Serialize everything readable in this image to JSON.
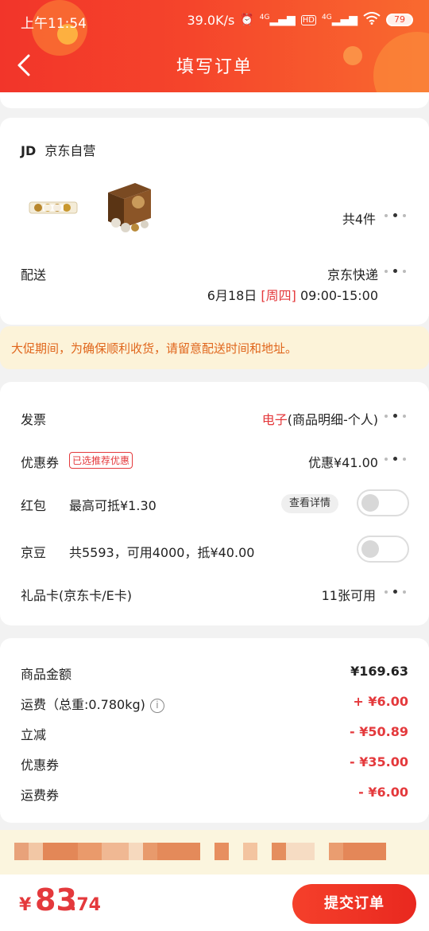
{
  "status_bar": {
    "time": "上午11:54",
    "net_speed": "39.0K/s",
    "battery": "79",
    "signal1": "4G",
    "hd": "HD",
    "signal2": "4G"
  },
  "header": {
    "title": "填写订单"
  },
  "shop": {
    "logo": "JD",
    "name": "京东自营",
    "item_count": "共4件"
  },
  "delivery": {
    "label": "配送",
    "carrier": "京东快递",
    "date": "6月18日",
    "weekday": "[周四]",
    "time_range": "09:00-15:00"
  },
  "notice": {
    "text": "大促期间，为确保顺利收货，请留意配送时间和地址。"
  },
  "invoice": {
    "label": "发票",
    "type_highlight": "电子",
    "type_rest": "(商品明细-个人)"
  },
  "coupon": {
    "label": "优惠券",
    "tag": "已选推荐优惠",
    "value": "优惠¥41.00"
  },
  "red_packet": {
    "label": "红包",
    "desc": "最高可抵¥1.30",
    "detail_button": "查看详情",
    "enabled": false
  },
  "jd_beans": {
    "label": "京豆",
    "desc": "共5593，可用4000，抵¥40.00",
    "enabled": false
  },
  "gift_card": {
    "label": "礼品卡(京东卡/E卡)",
    "value": "11张可用"
  },
  "summary": {
    "goods_label": "商品金额",
    "goods_value": "¥169.63",
    "shipping_label": "运费（总重:0.780kg)",
    "shipping_value": "+ ¥6.00",
    "discount_label": "立减",
    "discount_value": "- ¥50.89",
    "coupon_label": "优惠券",
    "coupon_value": "- ¥35.00",
    "ship_coupon_label": "运费券",
    "ship_coupon_value": "- ¥6.00"
  },
  "footer": {
    "currency": "¥",
    "price_int": "83",
    "price_dec": ".74",
    "submit_label": "提交订单"
  },
  "colors": {
    "brand_red": "#e4393c",
    "header_start": "#f2352a",
    "header_end": "#f96a2f",
    "notice_text": "#e0661c"
  }
}
